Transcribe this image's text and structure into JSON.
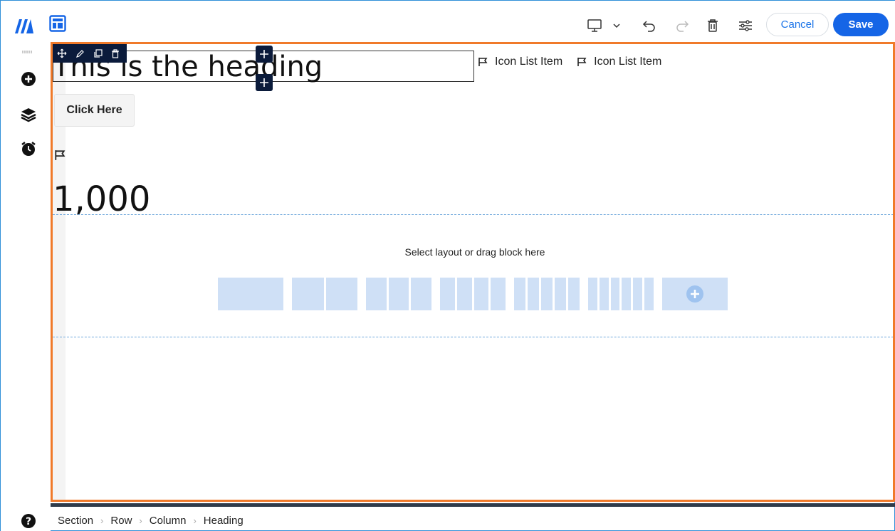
{
  "topbar": {
    "cancel_label": "Cancel",
    "save_label": "Save"
  },
  "canvas": {
    "heading": "This is the heading",
    "icon_list": [
      "Icon List Item",
      "Icon List Item"
    ],
    "button_label": "Click Here",
    "counter_value": "1,000",
    "dropzone_text": "Select layout or drag block here"
  },
  "layouts": [
    1,
    2,
    3,
    4,
    5,
    6
  ],
  "breadcrumb": [
    "Section",
    "Row",
    "Column",
    "Heading"
  ],
  "colors": {
    "accent": "#1565e6",
    "canvas_border": "#f07a2a",
    "layout_fill": "#cfe0f6",
    "toolbar_dark": "#0b1b3b"
  }
}
